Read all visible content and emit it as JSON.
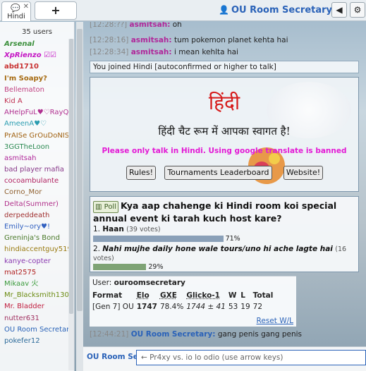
{
  "topbar": {
    "room_tab_label": "Hindi",
    "add_tab_label": "+",
    "user_name": "OU Room Secretary",
    "sound_icon": "speaker-mute-icon",
    "settings_icon": "gear-icon"
  },
  "userlist": {
    "count": "35 users",
    "users": [
      {
        "name": "Arsenal",
        "color": "#3b8f3b",
        "style": "italic"
      },
      {
        "name": "XpRienzo ☑☑",
        "color": "#c414c4",
        "style": "italic"
      },
      {
        "name": "abd1710",
        "color": "#c83232",
        "style": "bold"
      },
      {
        "name": "I'm Soapy?",
        "color": "#a66a10",
        "style": "bold"
      },
      {
        "name": "Bellematon",
        "color": "#c04080",
        "style": ""
      },
      {
        "name": "Kid A",
        "color": "#c03050",
        "style": ""
      },
      {
        "name": "AHelpFuL♥♡RayQ",
        "color": "#b03090",
        "style": ""
      },
      {
        "name": "AmeenA♥♡",
        "color": "#2a9cb0",
        "style": ""
      },
      {
        "name": "PrAISe GrOuDoNIS",
        "color": "#a06010",
        "style": ""
      },
      {
        "name": "3GGTheLoon",
        "color": "#2c8a52",
        "style": ""
      },
      {
        "name": "asmitsah",
        "color": "#b0289a",
        "style": ""
      },
      {
        "name": "bad player mafia",
        "color": "#8a3a8a",
        "style": ""
      },
      {
        "name": "cocoambulante",
        "color": "#b02060",
        "style": ""
      },
      {
        "name": "Corno_Mor",
        "color": "#906030",
        "style": ""
      },
      {
        "name": "Delta(Summer)",
        "color": "#b0308a",
        "style": ""
      },
      {
        "name": "derpeddeath",
        "color": "#a03030",
        "style": ""
      },
      {
        "name": "Emily~ory♥!",
        "color": "#3060c0",
        "style": ""
      },
      {
        "name": "Greninja's Bond",
        "color": "#4a7a2a",
        "style": ""
      },
      {
        "name": "hindiaccentguy519",
        "color": "#9a7a10",
        "style": ""
      },
      {
        "name": "kanye-copter",
        "color": "#8a3ab0",
        "style": ""
      },
      {
        "name": "mat2575",
        "color": "#b02020",
        "style": ""
      },
      {
        "name": "Mikaav 火",
        "color": "#3a9a3a",
        "style": ""
      },
      {
        "name": "Mr_Blacksmith1305",
        "color": "#6a8a10",
        "style": ""
      },
      {
        "name": "Mr. Bladder",
        "color": "#c02040",
        "style": ""
      },
      {
        "name": "nutter631",
        "color": "#a03060",
        "style": ""
      },
      {
        "name": "OU Room Secretary",
        "color": "#2a62b8",
        "style": ""
      },
      {
        "name": "pokefer12",
        "color": "#2c6a9a",
        "style": ""
      }
    ]
  },
  "chat": {
    "messages": [
      {
        "ts": "[12:28:??]",
        "name": "asmitsah:",
        "text": "oh"
      },
      {
        "ts": "[12:28:16]",
        "name": "asmitsah:",
        "text": "tum pokemon planet kehta hai"
      },
      {
        "ts": "[12:28:34]",
        "name": "asmitsah:",
        "text": "i mean kehlta hai"
      }
    ],
    "join_notice": "You joined Hindi [autoconfirmed or higher to talk]",
    "welcome": {
      "title": "हिंदी",
      "greeting": "हिंदी चैट रूम में आपका स्वागत है!",
      "warning": "Please only talk in Hindi. Using google translate is banned",
      "btn_rules": "Rules!",
      "btn_tournaments": "Tournaments Leaderboard",
      "btn_website": "Website!"
    },
    "poll": {
      "tag": "Poll",
      "tag_icon": "bar-chart-icon",
      "question": "Kya aap chahenge ki Hindi room koi special annual event ki tarah kuch host kare?",
      "options": [
        {
          "num": "1.",
          "label": "Haan",
          "votes": "(39 votes)",
          "pct": "71%",
          "fraction": 0.71
        },
        {
          "num": "2.",
          "label": "Nahi mujhe daily hone wale tours/uno hi ache lagte hai",
          "votes": "(16 votes)",
          "pct": "29%",
          "fraction": 0.29
        }
      ]
    },
    "stats": {
      "user_label": "User:",
      "user_name": "ouroomsecretary",
      "headers": [
        "Format",
        "Elo",
        "GXE",
        "Glicko-1",
        "W",
        "L",
        "Total"
      ],
      "row": [
        "[Gen 7] OU",
        "1747",
        "78.4%",
        "1744 ± 41",
        "53",
        "19",
        "72"
      ],
      "reset": "Reset W/L"
    },
    "last_message": {
      "ts": "[12:44:21]",
      "name": "OU Room Secretary:",
      "text": "gang penis gang penis"
    }
  },
  "input": {
    "who": "OU Room Se",
    "placeholder": "← Pr4xy vs. io lo odio (use arrow keys)"
  }
}
